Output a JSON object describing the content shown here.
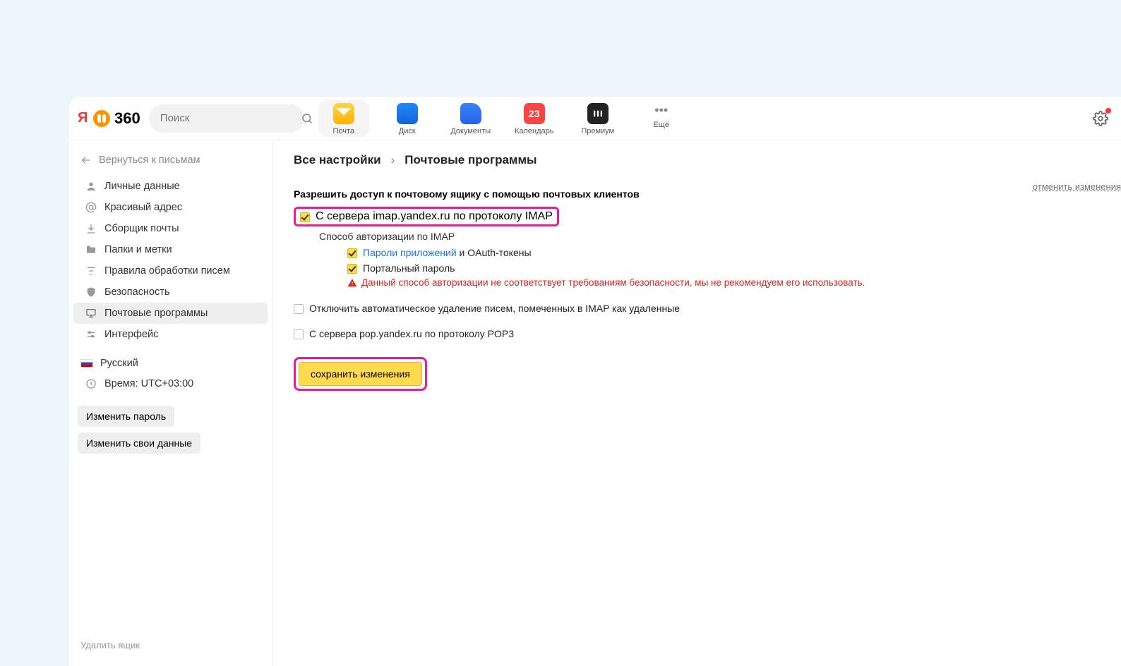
{
  "header": {
    "logo_text": "360",
    "search_placeholder": "Поиск",
    "apps": [
      {
        "label": "Почта"
      },
      {
        "label": "Диск"
      },
      {
        "label": "Документы"
      },
      {
        "label": "Календарь",
        "badge": "23"
      },
      {
        "label": "Премиум"
      },
      {
        "label": "Ещё"
      }
    ]
  },
  "sidebar": {
    "back": "Вернуться к письмам",
    "items": [
      {
        "label": "Личные данные"
      },
      {
        "label": "Красивый адрес"
      },
      {
        "label": "Сборщик почты"
      },
      {
        "label": "Папки и метки"
      },
      {
        "label": "Правила обработки писем"
      },
      {
        "label": "Безопасность"
      },
      {
        "label": "Почтовые программы"
      },
      {
        "label": "Интерфейс"
      }
    ],
    "language": "Русский",
    "time_label": "Время: UTC+03:00",
    "change_password": "Изменить пароль",
    "change_data": "Изменить свои данные",
    "delete_mailbox": "Удалить ящик"
  },
  "breadcrumb": {
    "root": "Все настройки",
    "current": "Почтовые программы"
  },
  "content": {
    "section_title": "Разрешить доступ к почтовому ящику с помощью почтовых клиентов",
    "undo": "отменить изменения",
    "imap_label": "С сервера imap.yandex.ru по протоколу IMAP",
    "auth_method_title": "Способ авторизации по IMAP",
    "app_passwords_link": "Пароли приложений",
    "app_passwords_suffix": " и OAuth-токены",
    "portal_password": "Портальный пароль",
    "warning": "Данный способ авторизации не соответствует требованиям безопасности, мы не рекомендуем его использовать.",
    "disable_autodelete": "Отключить автоматическое удаление писем, помеченных в IMAP как удаленные",
    "pop3_label": "С сервера pop.yandex.ru по протоколу POP3",
    "save_button": "сохранить изменения"
  }
}
